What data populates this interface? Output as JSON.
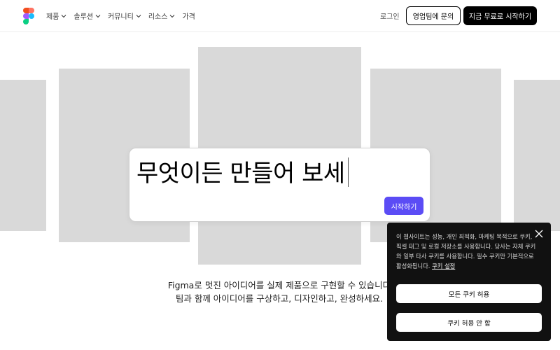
{
  "nav": {
    "items": [
      {
        "label": "제품",
        "has_dropdown": true
      },
      {
        "label": "솔루션",
        "has_dropdown": true
      },
      {
        "label": "커뮤니티",
        "has_dropdown": true
      },
      {
        "label": "리소스",
        "has_dropdown": true
      },
      {
        "label": "가격",
        "has_dropdown": false
      }
    ],
    "login_label": "로그인",
    "contact_sales_label": "영업팀에 문의",
    "start_free_label": "지금 무료로 시작하기"
  },
  "hero": {
    "prompt_text": "무엇이든 만들어 보세",
    "start_button_label": "시작하기",
    "accent_color": "#5b4cf5"
  },
  "tagline": {
    "brand": "Figma",
    "line1_rest": "로 멋진 아이디어를 실제 제품으로 구현할 수 있습니다",
    "line2": "팀과 함께 아이디어를 구상하고, 디자인하고, 완성하세요."
  },
  "cookie_banner": {
    "text": "이 웹사이트는 성능, 개인 최적화, 마케팅 목적으로 쿠키, 픽셀 태그 및 로컬 저장소를 사용합니다. 당사는 자체 쿠키와 일부 타사 쿠키를 사용합니다. 필수 쿠키만 기본적으로 활성화됩니다. ",
    "settings_link": "쿠키 설정",
    "allow_all_label": "모든 쿠키 허용",
    "deny_label": "쿠키 허용 안 함"
  },
  "icons": {
    "logo": "figma-logo",
    "dropdown": "chevron-down-icon",
    "close": "close-icon"
  }
}
